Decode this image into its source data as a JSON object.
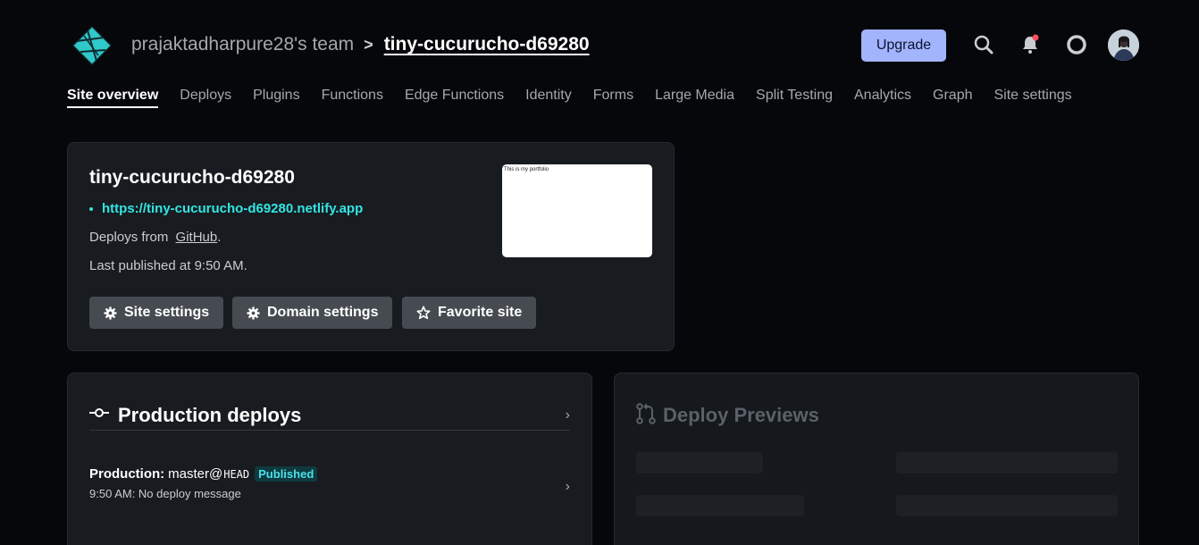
{
  "header": {
    "team": "prajaktadharpure28's team",
    "separator": ">",
    "site": "tiny-cucurucho-d69280",
    "upgrade_label": "Upgrade",
    "icons": [
      "search-icon",
      "bell-icon",
      "help-lifebuoy-icon",
      "avatar"
    ],
    "notification_dot_color": "#ff4d5a"
  },
  "nav": {
    "items": [
      "Site overview",
      "Deploys",
      "Plugins",
      "Functions",
      "Edge Functions",
      "Identity",
      "Forms",
      "Large Media",
      "Split Testing",
      "Analytics",
      "Graph",
      "Site settings"
    ],
    "active": "Site overview"
  },
  "site_card": {
    "title": "tiny-cucurucho-d69280",
    "url": "https://tiny-cucurucho-d69280.netlify.app",
    "deploys_prefix": "Deploys from",
    "deploys_link": "GitHub",
    "deploys_suffix": ".",
    "last_published": "Last published at 9:50 AM.",
    "thumbnail_text": "This is my portfolio",
    "buttons": {
      "site_settings": "Site settings",
      "domain_settings": "Domain settings",
      "favorite_site": "Favorite site"
    }
  },
  "production": {
    "title": "Production deploys",
    "row": {
      "label": "Production:",
      "branch": "master@",
      "ref": "HEAD",
      "status": "Published",
      "message": "9:50 AM: No deploy message"
    }
  },
  "previews": {
    "title": "Deploy Previews"
  },
  "colors": {
    "background": "#06070a",
    "card": "#181b20",
    "accent_teal": "#32e6e2",
    "upgrade_bg": "#a2b4fb"
  }
}
